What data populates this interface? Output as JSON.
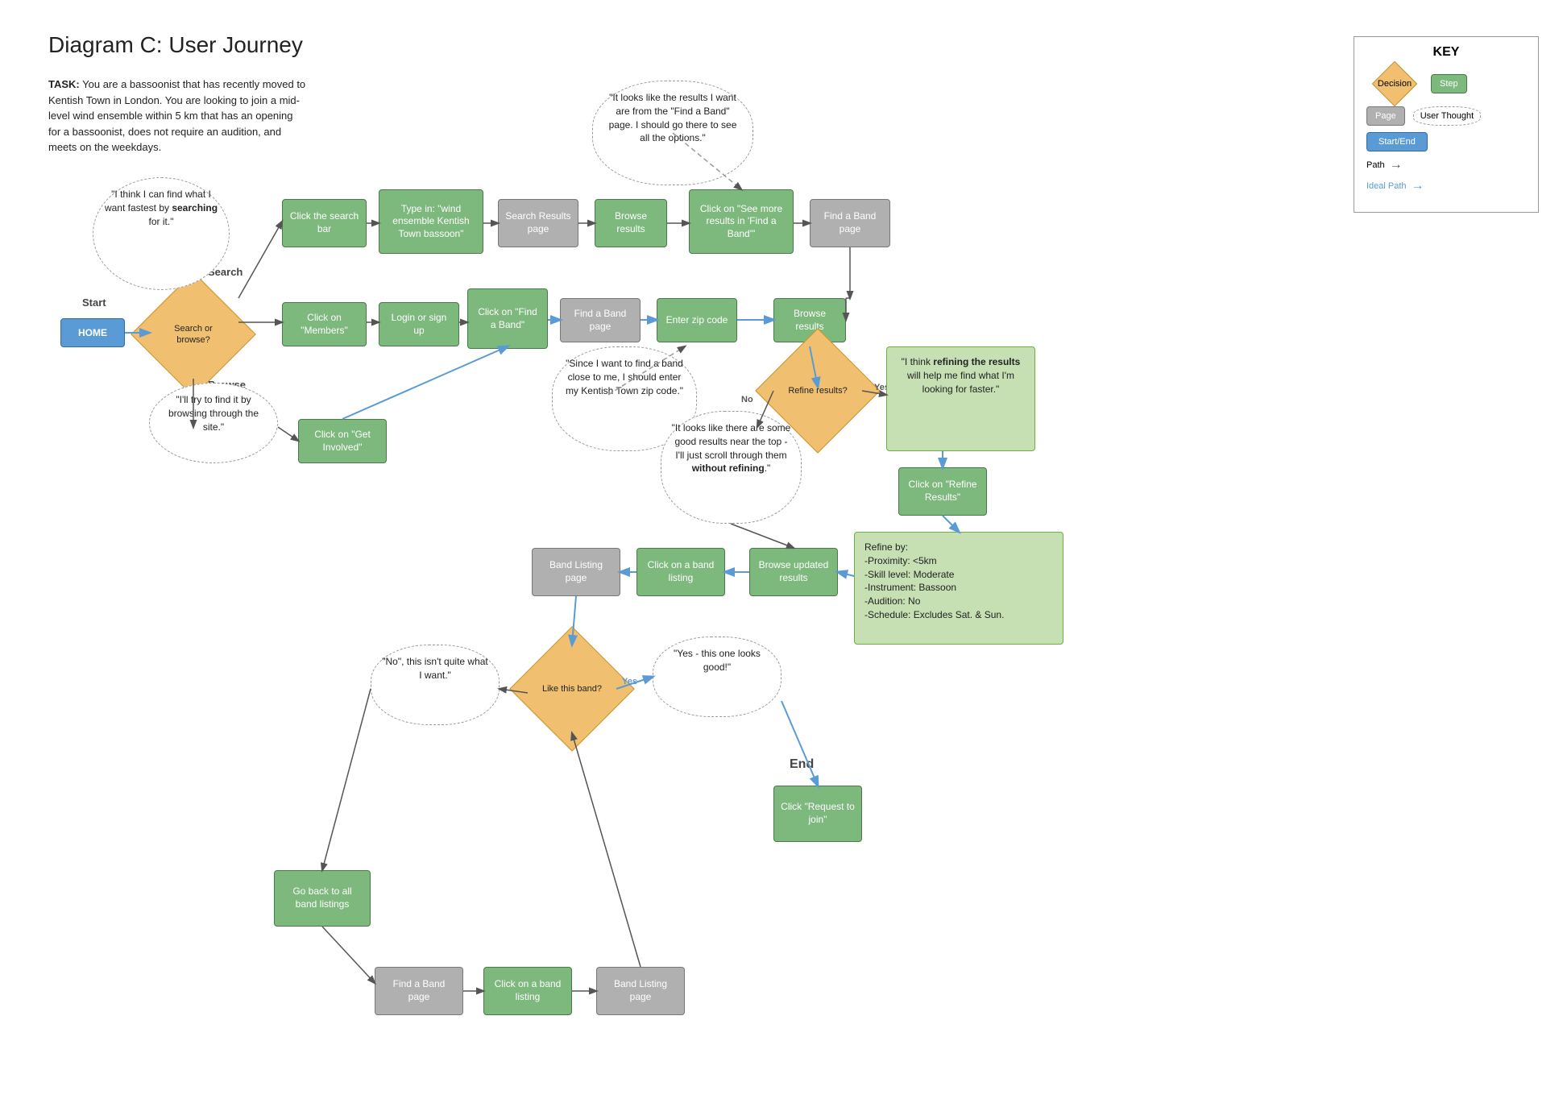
{
  "title": "Diagram C: User Journey",
  "task_label": "TASK:",
  "task_text": " You are a bassoonist that has recently moved to Kentish Town in London. You are looking to join a mid-level wind ensemble within 5 km that has an opening for a bassoonist, does not require an audition, and meets on the weekdays.",
  "key": {
    "title": "KEY",
    "decision_label": "Decision",
    "step_label": "Step",
    "page_label": "Page",
    "user_thought_label": "User Thought",
    "start_end_label": "Start/End",
    "path_label": "Path",
    "ideal_path_label": "Ideal Path"
  },
  "nodes": {
    "start_label": "Start",
    "home": "HOME",
    "search_browse": "Search or browse?",
    "search_label": "Search",
    "browse_label": "Browse",
    "click_search_bar": "Click the search bar",
    "type_in": "Type in: \"wind ensemble Kentish Town bassoon\"",
    "search_results_page": "Search Results page",
    "browse_results_1": "Browse results",
    "see_more_results": "Click on \"See more results in 'Find a Band'\"",
    "find_band_page_1": "Find a Band page",
    "thought_results": "\"It looks like the results I want are from the \"Find a Band\" page. I should go there to see all the options.\"",
    "click_members": "Click on \"Members\"",
    "login_signup": "Login or sign up",
    "click_find_band": "Click on \"Find a Band\"",
    "find_band_page_2": "Find a Band page",
    "enter_zip": "Enter zip code",
    "browse_results_2": "Browse results",
    "thought_browse": "\"I'll try to find it by browsing through the site.\"",
    "thought_search": "\"I think I can find what I want fastest by searching for it.\"",
    "click_get_involved": "Click on \"Get Involved\"",
    "thought_zip": "\"Since I want to find a band close to me, I should enter my Kentish Town zip code.\"",
    "refine_results": "Refine results?",
    "thought_no_refine": "\"It looks like there are some good results near the top - I'll just scroll through them without refining.\"",
    "thought_yes_refine": "\"I think refining the results will help me find what I'm looking for faster.\"",
    "click_refine": "Click on \"Refine Results\"",
    "refine_by_box": "Refine by:\n-Proximity: <5km\n-Skill level: Moderate\n-Instrument: Bassoon\n-Audition: No\n-Schedule: Excludes Sat. & Sun.",
    "browse_updated": "Browse updated results",
    "click_band_listing_1": "Click on a band listing",
    "band_listing_page_1": "Band Listing page",
    "like_band": "Like this band?",
    "thought_yes": "\"Yes - this one looks good!\"",
    "thought_no": "\"No\", this isn't quite what I want.\"",
    "click_request": "Click \"Request to join\"",
    "end_label": "End",
    "go_back": "Go back to all band listings",
    "find_band_page_3": "Find a Band page",
    "click_band_listing_2": "Click on a band listing",
    "band_listing_page_2": "Band Listing page"
  }
}
